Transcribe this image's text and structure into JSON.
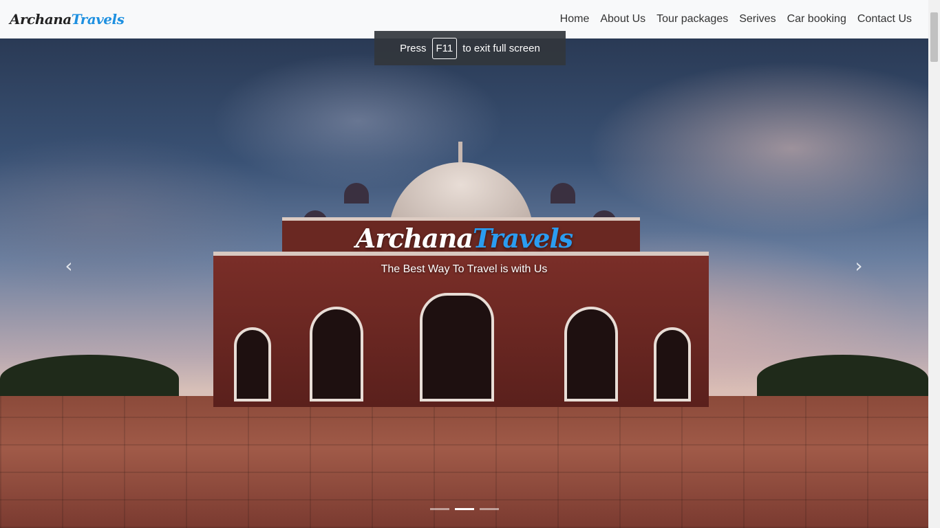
{
  "brand": {
    "part1": "Archana",
    "part2": "Travels"
  },
  "nav": {
    "items": [
      "Home",
      "About Us",
      "Tour packages",
      "Serives",
      "Car booking",
      "Contact Us"
    ]
  },
  "fullscreen_notice": {
    "prefix": "Press",
    "key": "F11",
    "suffix": "to exit full screen"
  },
  "hero": {
    "brand_part1": "Archana",
    "brand_part2": "Travels",
    "tagline": "The Best Way To Travel is with Us",
    "prev_icon": "‹",
    "next_icon": "›",
    "slides": 3,
    "active_slide": 2
  },
  "colors": {
    "brand_dark": "#222222",
    "brand_blue": "#1e90e0",
    "navbar_bg": "#f8f9fa"
  }
}
